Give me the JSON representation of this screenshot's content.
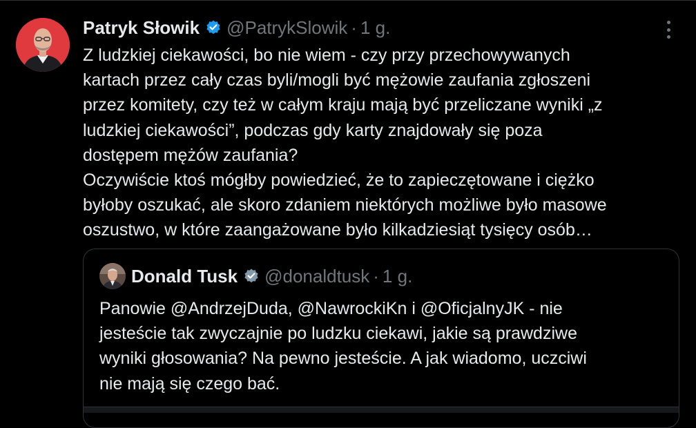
{
  "post": {
    "author_name": "Patryk Słowik",
    "handle": "@PatrykSlowik",
    "separator": "·",
    "time": "1 g.",
    "text": "Z ludzkiej ciekawości, bo nie wiem - czy przy przechowywanych\nkartach przez cały czas byli/mogli być mężowie zaufania zgłoszeni\nprzez komitety, czy też w całym kraju mają być przeliczane wyniki „z\nludzkiej ciekawości”, podczas gdy karty znajdowały się poza\ndostępem mężów zaufania?\nOczywiście ktoś mógłby powiedzieć, że to zapieczętowane i ciężko\nbyłoby oszukać, ale skoro zdaniem niektórych możliwe było masowe\noszustwo, w które zaangażowane było kilkadziesiąt tysięcy osób…",
    "avatar_icon": "person-avatar-icon",
    "verified_icon": "verified-badge-icon",
    "more_icon": "more-options-icon"
  },
  "quote": {
    "author_name": "Donald Tusk",
    "handle": "@donaldtusk",
    "separator": "·",
    "time": "1 g.",
    "text": "Panowie @AndrzejDuda, @NawrockiKn i @OficjalnyJK - nie\njesteście tak zwyczajnie po ludzku ciekawi, jakie są prawdziwe\nwyniki głosowania? Na pewno jesteście. A jak wiadomo, uczciwi\nnie mają się czego bać."
  },
  "colors": {
    "background": "#000000",
    "text": "#e7e9ea",
    "muted": "#71767b",
    "border": "#2f3336",
    "verified_blue": "#1d9bf0",
    "verified_gray": "#829aab",
    "avatar_bg": "#e0393e"
  }
}
